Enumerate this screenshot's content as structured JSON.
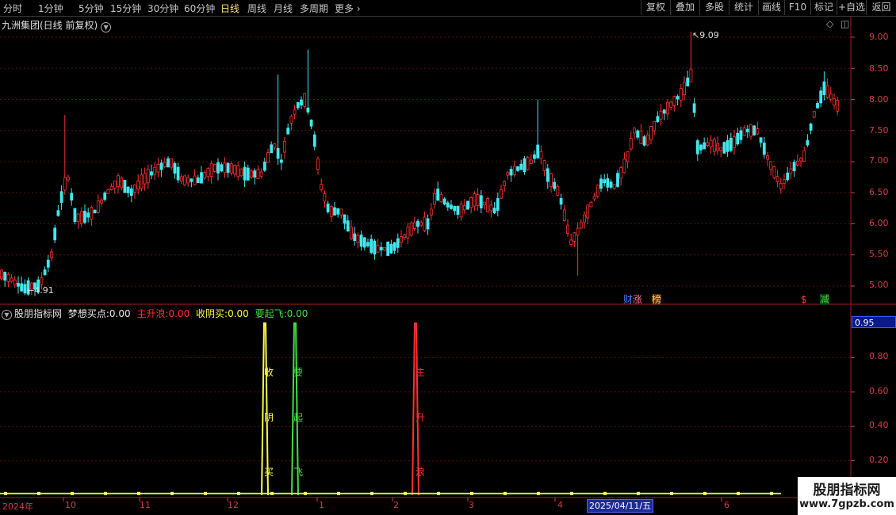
{
  "toolbar": {
    "periods": [
      "分时",
      "1分钟",
      "5分钟",
      "15分钟",
      "30分钟",
      "60分钟",
      "日线",
      "周线",
      "月线",
      "多周期",
      "更多"
    ],
    "active_period": "日线",
    "buttons": [
      "复权",
      "叠加",
      "多股",
      "统计",
      "画线",
      "F10",
      "标记",
      "+自选",
      "返回"
    ]
  },
  "stock": {
    "title": "九洲集团(日线 前复权)",
    "high_label": "9.09",
    "low_label": "4.91",
    "price_axis": [
      "9.00",
      "8.50",
      "8.00",
      "7.50",
      "7.00",
      "6.50",
      "6.00",
      "5.50",
      "5.00"
    ]
  },
  "tags": [
    {
      "text": "财",
      "color": "#4a7aff"
    },
    {
      "text": "涨",
      "color": "#ff7090"
    },
    {
      "text": "榜",
      "color": "#ffd040"
    },
    {
      "text": "$",
      "color": "#ff4040"
    },
    {
      "text": "减",
      "color": "#40d040"
    }
  ],
  "indicator": {
    "name": "股朋指标网",
    "series": [
      {
        "label": "梦想买点:",
        "value": "0.00",
        "color": "#e8e8e8"
      },
      {
        "label": "主升浪:",
        "value": "0.00",
        "color": "#ff3030"
      },
      {
        "label": "收阴买:",
        "value": "0.00",
        "color": "#ffff40"
      },
      {
        "label": "要起飞:",
        "value": "0.00",
        "color": "#40e040"
      }
    ],
    "axis": [
      "0.80",
      "0.60",
      "0.40",
      "0.20"
    ],
    "current_value": "0.95",
    "signals": [
      {
        "chars": [
          "收",
          "阴",
          "买"
        ],
        "color": "#ffff40"
      },
      {
        "chars": [
          "要",
          "起",
          "飞"
        ],
        "color": "#40e040"
      },
      {
        "chars": [
          "主",
          "升",
          "浪"
        ],
        "color": "#ff3030"
      }
    ]
  },
  "x_axis": [
    "2024年",
    "10",
    "11",
    "12",
    "1",
    "2",
    "3",
    "4",
    "6"
  ],
  "cursor_date": "2025/04/11/五",
  "watermark": {
    "line1": "股朋指标网",
    "line2": "www.7gpzb.com"
  },
  "colors": {
    "up": "#ff3030",
    "down": "#40e8f0",
    "axis": "#d04040"
  }
}
